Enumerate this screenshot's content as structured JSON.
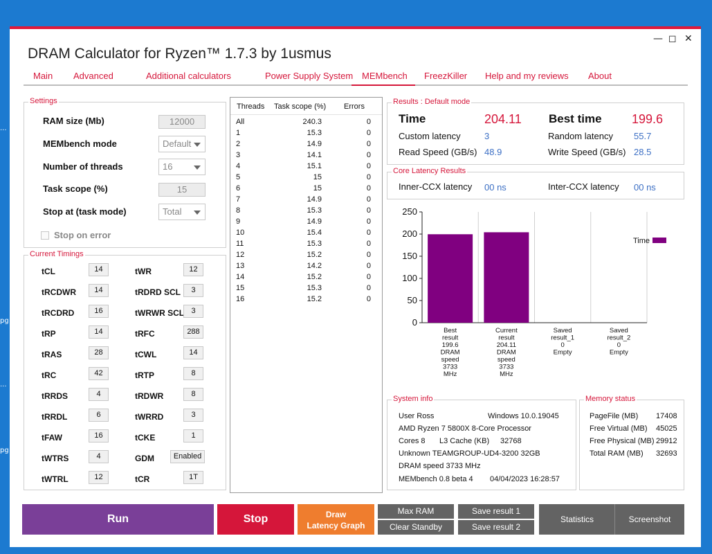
{
  "window": {
    "title": "DRAM Calculator for Ryzen™ 1.7.3 by 1usmus",
    "controls": {
      "minimize": "—",
      "maximize": "◻",
      "close": "✕"
    }
  },
  "tabs": [
    "Main",
    "Advanced",
    "Additional calculators",
    "Power Supply System",
    "MEMbench",
    "FreezKiller",
    "Help and my reviews",
    "About"
  ],
  "settings": {
    "title": "Settings",
    "ram_size_label": "RAM size (Mb)",
    "ram_size_value": "12000",
    "mode_label": "MEMbench mode",
    "mode_value": "Default",
    "threads_label": "Number of threads",
    "threads_value": "16",
    "scope_label": "Task scope (%)",
    "scope_value": "15",
    "stop_label": "Stop at (task mode)",
    "stop_value": "Total",
    "stop_on_error_label": "Stop on error"
  },
  "timings": {
    "title": "Current Timings",
    "left": [
      {
        "label": "tCL",
        "value": "14"
      },
      {
        "label": "tRCDWR",
        "value": "14"
      },
      {
        "label": "tRCDRD",
        "value": "16"
      },
      {
        "label": "tRP",
        "value": "14"
      },
      {
        "label": "tRAS",
        "value": "28"
      },
      {
        "label": "tRC",
        "value": "42"
      },
      {
        "label": "tRRDS",
        "value": "4"
      },
      {
        "label": "tRRDL",
        "value": "6"
      },
      {
        "label": "tFAW",
        "value": "16"
      },
      {
        "label": "tWTRS",
        "value": "4"
      },
      {
        "label": "tWTRL",
        "value": "12"
      }
    ],
    "right": [
      {
        "label": "tWR",
        "value": "12"
      },
      {
        "label": "tRDRD SCL",
        "value": "3"
      },
      {
        "label": "tWRWR SCL",
        "value": "3"
      },
      {
        "label": "tRFC",
        "value": "288"
      },
      {
        "label": "tCWL",
        "value": "14"
      },
      {
        "label": "tRTP",
        "value": "8"
      },
      {
        "label": "tRDWR",
        "value": "8"
      },
      {
        "label": "tWRRD",
        "value": "3"
      },
      {
        "label": "tCKE",
        "value": "1"
      },
      {
        "label": "GDM",
        "value": "Enabled"
      },
      {
        "label": "tCR",
        "value": "1T"
      }
    ]
  },
  "threads_table": {
    "headers": [
      "Threads",
      "Task scope (%)",
      "Errors"
    ],
    "rows": [
      [
        "All",
        "240.3",
        "0"
      ],
      [
        "1",
        "15.3",
        "0"
      ],
      [
        "2",
        "14.9",
        "0"
      ],
      [
        "3",
        "14.1",
        "0"
      ],
      [
        "4",
        "15.1",
        "0"
      ],
      [
        "5",
        "15",
        "0"
      ],
      [
        "6",
        "15",
        "0"
      ],
      [
        "7",
        "14.9",
        "0"
      ],
      [
        "8",
        "15.3",
        "0"
      ],
      [
        "9",
        "14.9",
        "0"
      ],
      [
        "10",
        "15.4",
        "0"
      ],
      [
        "11",
        "15.3",
        "0"
      ],
      [
        "12",
        "15.2",
        "0"
      ],
      [
        "13",
        "14.2",
        "0"
      ],
      [
        "14",
        "15.2",
        "0"
      ],
      [
        "15",
        "15.3",
        "0"
      ],
      [
        "16",
        "15.2",
        "0"
      ]
    ]
  },
  "results": {
    "title": "Results : Default mode",
    "time_label": "Time",
    "time_value": "204.11",
    "best_label": "Best time",
    "best_value": "199.6",
    "custom_latency_label": "Custom latency",
    "custom_latency_value": "3",
    "random_latency_label": "Random latency",
    "random_latency_value": "55.7",
    "read_label": "Read Speed (GB/s)",
    "read_value": "48.9",
    "write_label": "Write Speed (GB/s)",
    "write_value": "28.5"
  },
  "core_latency": {
    "title": "Core Latency Results",
    "inner_label": "Inner-CCX latency",
    "inner_value": "00 ns",
    "inter_label": "Inter-CCX latency",
    "inter_value": "00 ns"
  },
  "chart_data": {
    "type": "bar",
    "categories": [
      [
        "Best",
        "result",
        "199.6",
        "DRAM",
        "speed",
        "3733",
        "MHz"
      ],
      [
        "Current",
        "result",
        "204.11",
        "DRAM",
        "speed",
        "3733",
        "MHz"
      ],
      [
        "Saved",
        "result_1",
        "0",
        "Empty"
      ],
      [
        "Saved",
        "result_2",
        "0",
        "Empty"
      ]
    ],
    "series": [
      {
        "name": "Time",
        "values": [
          199.6,
          204.11,
          0,
          0
        ],
        "color": "#800080"
      }
    ],
    "y_ticks": [
      "0",
      "50",
      "100",
      "150",
      "200",
      "250"
    ],
    "ylim": [
      0,
      250
    ],
    "legend_position": "top-right",
    "grid": "vertical"
  },
  "system_info": {
    "title": "System info",
    "user": "User Ross",
    "os": "Windows 10.0.19045",
    "cpu": "AMD Ryzen 7 5800X 8-Core Processor",
    "cores": "Cores 8",
    "l3_label": "L3 Cache (KB)",
    "l3_value": "32768",
    "memory": "Unknown TEAMGROUP-UD4-3200 32GB",
    "dram_speed": "DRAM speed 3733 MHz",
    "version": "MEMbench 0.8 beta 4",
    "date": "04/04/2023 16:28:57"
  },
  "memory_status": {
    "title": "Memory status",
    "items": [
      {
        "label": "PageFile (MB)",
        "value": "17408"
      },
      {
        "label": "Free Virtual (MB)",
        "value": "45025"
      },
      {
        "label": "Free Physical (MB)",
        "value": "29912"
      },
      {
        "label": "Total RAM (MB)",
        "value": "32693"
      }
    ]
  },
  "buttons": {
    "run": "Run",
    "stop": "Stop",
    "draw_line1": "Draw",
    "draw_line2": "Latency Graph",
    "max_ram": "Max RAM",
    "clear_standby": "Clear Standby",
    "save1": "Save result 1",
    "save2": "Save result 2",
    "statistics": "Statistics",
    "screenshot": "Screenshot"
  },
  "colors": {
    "accent": "#d5163a",
    "run": "#7a3f98",
    "stop": "#d5163a",
    "draw": "#ef7d2e",
    "gray_button": "#636363",
    "link_value": "#3c6fc4"
  },
  "desktop_fragments": [
    "...",
    "pg",
    "...",
    "pg"
  ]
}
